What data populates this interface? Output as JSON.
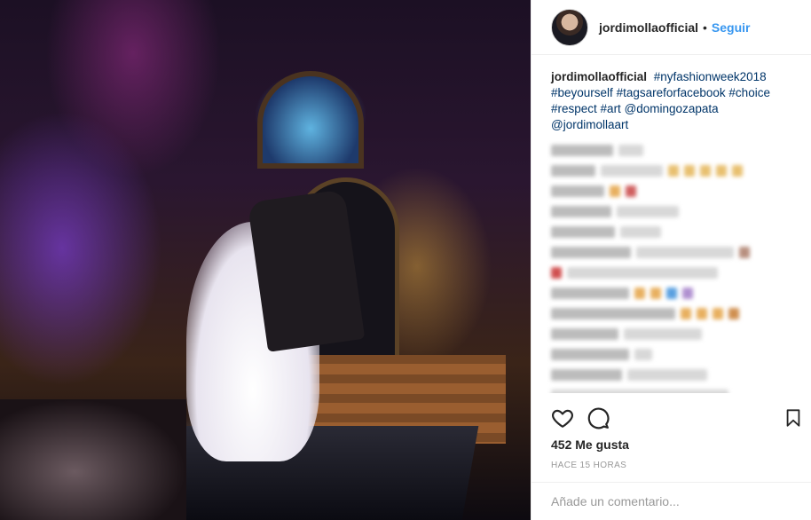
{
  "post": {
    "username": "jordimollaofficial",
    "separator": "•",
    "follow_label": "Seguir",
    "caption": {
      "username": "jordimollaofficial",
      "tokens": [
        "#nyfashionweek2018",
        "#beyourself",
        "#tagsareforfacebook",
        "#choice",
        "#respect",
        "#art",
        "@domingozapata",
        "@jordimollaart"
      ]
    },
    "likes_label": "452 Me gusta",
    "timestamp_label": "HACE 15 HORAS",
    "comment_placeholder": "Añade un comentario..."
  },
  "icons": {
    "like": "heart-icon",
    "comment": "comment-bubble-icon",
    "save": "bookmark-icon"
  },
  "colors": {
    "link": "#003569",
    "follow": "#3897f0",
    "muted": "#999999",
    "border": "#efefef"
  }
}
